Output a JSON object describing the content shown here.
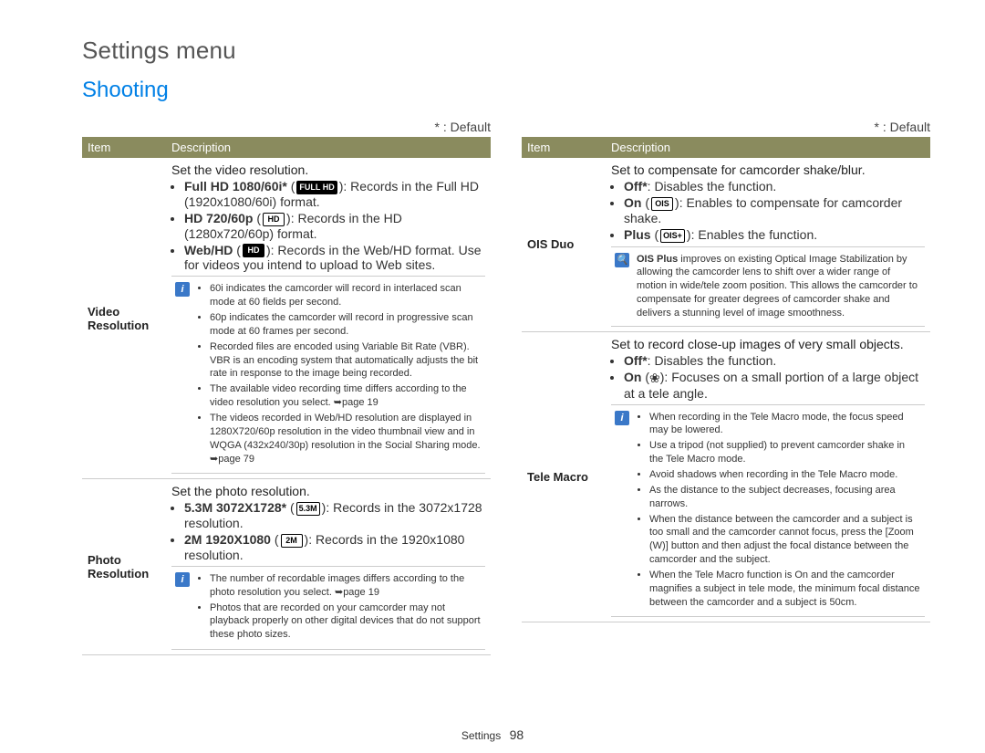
{
  "header": {
    "super": "Settings menu",
    "section": "Shooting",
    "default_note": "* : Default"
  },
  "table_headers": {
    "item": "Item",
    "desc": "Description"
  },
  "footer": {
    "label": "Settings",
    "page": "98"
  },
  "icons": {
    "full_hd": "FULL HD",
    "hd_bold": "HD",
    "web_hd": "HD",
    "m53": "5.3M",
    "m2": "2M",
    "ois_on": "OIS",
    "ois_plus": "OIS+",
    "flower": "❀",
    "magnifier": "🔍",
    "ref_arrow": "➥"
  },
  "left": [
    {
      "item": "Video Resolution",
      "lead": "Set the video resolution.",
      "opts": [
        {
          "b": "Full HD 1080/60i*",
          "icon": "full_hd",
          "rest": ": Records in the Full HD (1920x1080/60i) format."
        },
        {
          "b": "HD 720/60p",
          "icon": "hd_bold",
          "rest": ": Records in the HD (1280x720/60p) format."
        },
        {
          "b": "Web/HD",
          "icon": "web_hd",
          "rest": ": Records in the Web/HD format. Use for videos you intend to upload to Web sites."
        }
      ],
      "info": [
        "60i indicates the camcorder will record in interlaced scan mode at 60 fields per second.",
        "60p indicates the camcorder will record in progressive scan mode at 60 frames per second.",
        "Recorded files are encoded using Variable Bit Rate (VBR). VBR is an encoding system that automatically adjusts the bit rate in response to the image being recorded.",
        "The available video recording time differs according to the video resolution you select. ➥page 19",
        "The videos recorded in Web/HD resolution are displayed in 1280X720/60p resolution in the video thumbnail view and in WQGA (432x240/30p) resolution in the Social Sharing mode. ➥page 79"
      ]
    },
    {
      "item": "Photo Resolution",
      "lead": "Set the photo resolution.",
      "opts": [
        {
          "b": "5.3M 3072X1728*",
          "icon": "m53",
          "rest": ": Records in the 3072x1728 resolution."
        },
        {
          "b": "2M 1920X1080",
          "icon": "m2",
          "rest": ": Records in the 1920x1080 resolution."
        }
      ],
      "info": [
        "The number of recordable images differs according to the photo resolution you select. ➥page 19",
        "Photos that are recorded on your camcorder may not playback properly on other digital devices that do not support these photo sizes."
      ]
    }
  ],
  "right": [
    {
      "item": "OIS Duo",
      "lead": "Set to compensate for camcorder shake/blur.",
      "opts": [
        {
          "b": "Off*",
          "rest": ": Disables the function."
        },
        {
          "b": "On",
          "icon": "ois_on",
          "rest": ": Enables to compensate for camcorder shake."
        },
        {
          "b": "Plus",
          "icon": "ois_plus",
          "rest": ": Enables the function."
        }
      ],
      "info_lead_icon": "magnifier",
      "info_lead_bold": "OIS Plus",
      "info_lead_rest": " improves on existing Optical Image Stabilization by allowing the camcorder lens to shift over a wider range of motion in wide/tele zoom position. This allows the camcorder to compensate for greater degrees of camcorder shake and delivers a stunning level of image smoothness."
    },
    {
      "item": "Tele Macro",
      "lead": "Set to record close-up images of very small objects.",
      "opts": [
        {
          "b": "Off*",
          "rest": ": Disables the function."
        },
        {
          "b": "On",
          "icon": "flower",
          "glyph": true,
          "rest": ": Focuses on a small portion of a large object at a tele angle."
        }
      ],
      "info": [
        "When recording in the Tele Macro mode, the focus speed may be lowered.",
        "Use a tripod (not supplied) to prevent camcorder shake in the Tele Macro mode.",
        "Avoid shadows when recording in the Tele Macro mode.",
        "As the distance to the subject decreases, focusing area narrows.",
        "When the distance between the camcorder and a subject is too small and the camcorder cannot focus, press the [Zoom (W)] button and then adjust the focal distance between the camcorder and the subject.",
        "When the Tele Macro function is On and the camcorder magnifies a subject in tele mode, the minimum focal distance between the camcorder and a subject is 50cm."
      ],
      "info_bold_in_5": "On",
      "info_bold_in_4_a": "Zoom",
      "info_bold_in_4_b": "W"
    }
  ]
}
